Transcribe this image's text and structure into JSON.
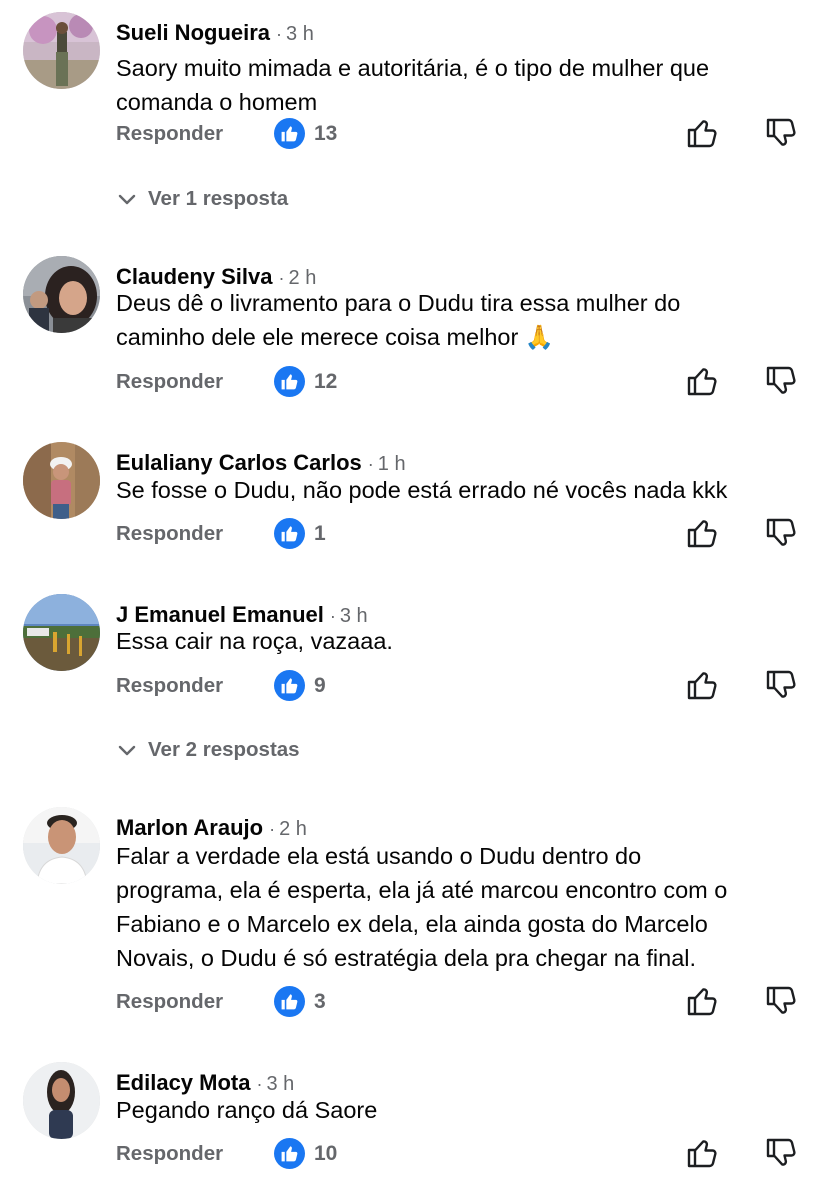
{
  "comments": [
    {
      "author": "Sueli Nogueira",
      "time": "3 h",
      "text": "Saory muito mimada e autoritária,  é  o tipo de mulher que\ncomanda o homem",
      "reply_label": "Responder",
      "likes": "13",
      "view_replies": "Ver 1 resposta"
    },
    {
      "author": "Claudeny Silva",
      "time": "2 h",
      "text": "Deus dê o livramento para o Dudu tira essa mulher do\ncaminho dele ele merece coisa melhor 🙏",
      "reply_label": "Responder",
      "likes": "12"
    },
    {
      "author": "Eulaliany Carlos Carlos",
      "time": "1 h",
      "text": "Se fosse o Dudu,  não pode está errado né vocês nada kkk",
      "reply_label": "Responder",
      "likes": "1"
    },
    {
      "author": "J Emanuel Emanuel",
      "time": "3 h",
      "text": "Essa cair na roça, vazaaa.",
      "reply_label": "Responder",
      "likes": "9",
      "view_replies": "Ver 2 respostas"
    },
    {
      "author": "Marlon Araujo",
      "time": "2 h",
      "text": "Falar a verdade ela está usando o Dudu dentro do\nprograma, ela é esperta, ela já até marcou encontro com o\nFabiano e o Marcelo ex dela, ela ainda gosta do Marcelo\nNovais, o Dudu é só estratégia dela pra chegar na final.",
      "reply_label": "Responder",
      "likes": "3"
    },
    {
      "author": "Edilacy Mota",
      "time": "3 h",
      "text": "Pegando ranço dá Saore",
      "reply_label": "Responder",
      "likes": "10"
    }
  ],
  "icons": {
    "like_badge": "thumbs-up-icon",
    "like_action": "thumbs-up-outline-icon",
    "dislike_action": "thumbs-down-outline-icon",
    "expand": "chevron-down-icon"
  },
  "colors": {
    "accent_like": "#1a77f2",
    "secondary_text": "#65676b",
    "primary_text": "#050505"
  }
}
